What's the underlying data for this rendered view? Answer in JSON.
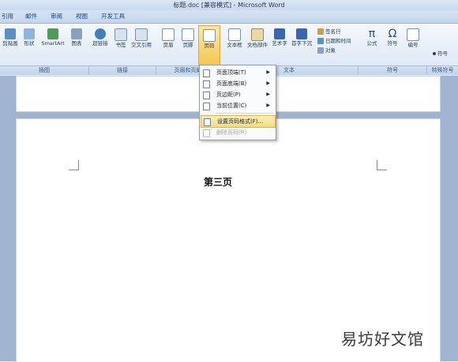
{
  "window": {
    "title": "标题.doc [兼容模式] - Microsoft Word"
  },
  "tabs": [
    "引用",
    "邮件",
    "审阅",
    "视图",
    "开发工具"
  ],
  "ribbon": {
    "insert_buttons": [
      "剪贴画",
      "形状",
      "SmartArt",
      "图表",
      "超链接",
      "书签",
      "交叉引用",
      "页眉",
      "页脚",
      "页码",
      "文本框",
      "文档部件",
      "艺术字",
      "首字下沉"
    ],
    "text_small": [
      "签名行",
      "日期和时间",
      "对象"
    ],
    "symbol_buttons": [
      "公式",
      "符号",
      "编号"
    ],
    "extra": "符号",
    "group_labels": [
      "插图",
      "链接",
      "页眉和页脚",
      "文本",
      "符号",
      "特殊符号"
    ]
  },
  "menu": {
    "items": [
      {
        "label": "页面顶端(T)",
        "has_submenu": true
      },
      {
        "label": "页面底端(B)",
        "has_submenu": true
      },
      {
        "label": "页边距(P)",
        "has_submenu": true
      },
      {
        "label": "当前位置(C)",
        "has_submenu": true
      },
      {
        "label": "设置页码格式(F)...",
        "has_submenu": false,
        "highlighted": true
      },
      {
        "label": "删除页码(R)",
        "has_submenu": false,
        "disabled": true
      }
    ]
  },
  "document": {
    "page_text": "第三页"
  },
  "watermark": "易坊好文馆",
  "colors": {
    "accent": "#15428b",
    "highlight": "#f8d979",
    "background": "#9fb4cf"
  }
}
